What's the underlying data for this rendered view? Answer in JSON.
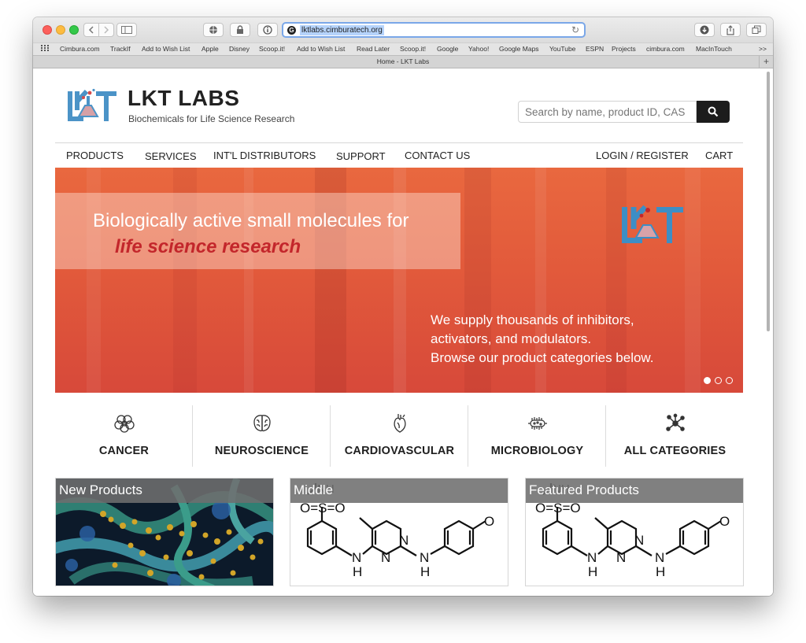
{
  "browser": {
    "url": "lktlabs.cimburatech.org",
    "tab_title": "Home - LKT Labs",
    "bookmarks": [
      "Cimbura.com",
      "TrackIf",
      "Add to Wish List",
      "Apple",
      "Disney",
      "Scoop.it!",
      "Add to Wish List",
      "Read Later",
      "Scoop.it!",
      "Google",
      "Yahoo!",
      "Google Maps",
      "YouTube",
      "ESPN",
      "Projects",
      "cimbura.com",
      "MacInTouch"
    ],
    "overflow": ">>",
    "new_tab": "+"
  },
  "header": {
    "brand": "LKT LABS",
    "tagline": "Biochemicals for Life Science Research",
    "search_placeholder": "Search by name, product ID, CAS"
  },
  "nav": {
    "items": [
      "PRODUCTS",
      "SERVICES",
      "INT'L DISTRIBUTORS",
      "SUPPORT",
      "CONTACT US",
      "LOGIN / REGISTER",
      "CART"
    ]
  },
  "hero": {
    "headline": "Biologically active small molecules for",
    "headline_accent": "life science research",
    "body_lines": [
      "We supply thousands of inhibitors,",
      "activators, and modulators.",
      "Browse our product categories below."
    ],
    "slide_count": 3,
    "active_slide": 1
  },
  "categories": [
    {
      "label": "CANCER",
      "icon": "cell-cluster-icon"
    },
    {
      "label": "NEUROSCIENCE",
      "icon": "brain-icon"
    },
    {
      "label": "CARDIOVASCULAR",
      "icon": "heart-icon"
    },
    {
      "label": "MICROBIOLOGY",
      "icon": "bacterium-icon"
    },
    {
      "label": "ALL CATEGORIES",
      "icon": "molecule-icon"
    }
  ],
  "cards": [
    {
      "title": "New Products"
    },
    {
      "title": "Middle"
    },
    {
      "title": "Featured Products"
    }
  ],
  "structure_labels": {
    "sulfonyl": "O=S=O",
    "amine_top": "NH",
    "nitrogen": "N",
    "amine_h": "H",
    "oxygen": "O"
  },
  "colors": {
    "brand_blue": "#3d8ec5",
    "hero_orange": "#e25a3b",
    "accent_red": "#c3262b",
    "search_button": "#1c1c1c"
  }
}
